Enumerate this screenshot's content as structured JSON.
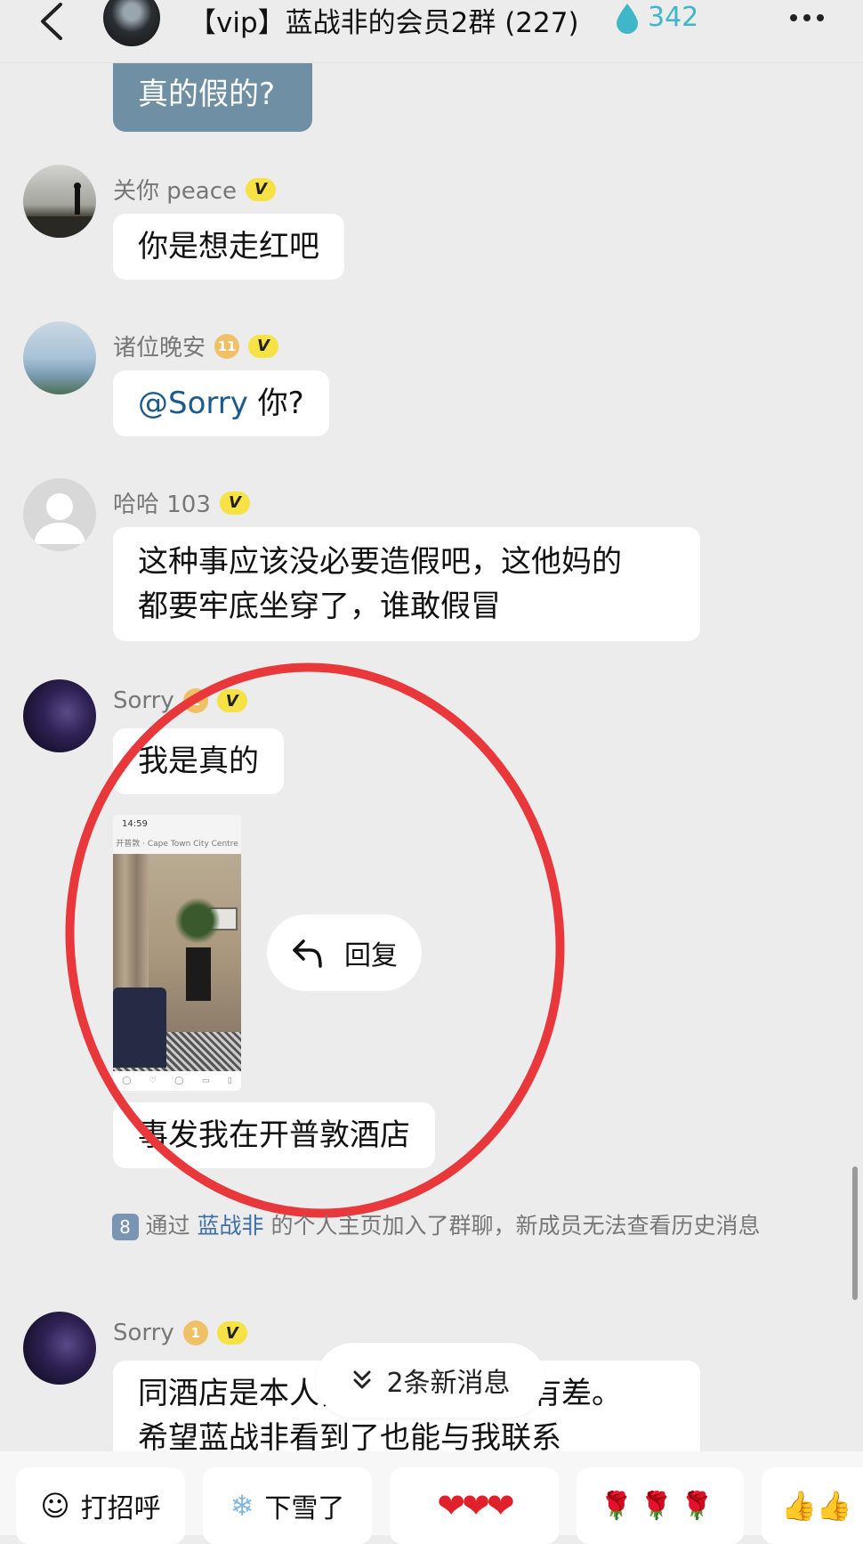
{
  "header": {
    "back_icon": "chevron-left-icon",
    "title": "【vip】蓝战非的会员2群 (227)",
    "heat_icon": "water-drop-icon",
    "heat_count": "342",
    "more_icon": "more-horizontal-icon"
  },
  "messages": [
    {
      "id": "m1",
      "sender": "",
      "self": true,
      "text": "真的假的?"
    },
    {
      "id": "m2",
      "sender": "关你 peace",
      "badges": [
        "v"
      ],
      "text": "你是想走红吧"
    },
    {
      "id": "m3",
      "sender": "诸位晚安",
      "level": "11",
      "badges": [
        "v"
      ],
      "mention": "@Sorry",
      "text": " 你?"
    },
    {
      "id": "m4",
      "sender": "哈哈 103",
      "badges": [
        "v"
      ],
      "lines": [
        "这种事应该没必要造假吧，这他妈的",
        "都要牢底坐穿了，谁敢假冒"
      ]
    },
    {
      "id": "m5",
      "sender": "Sorry",
      "level": "1",
      "badges": [
        "v"
      ],
      "text": "我是真的",
      "image": "hotel-room-screenshot",
      "image_status_time": "14:59",
      "image_nav_title": "开普敦 · Cape Town City Centre",
      "caption": "事发我在开普敦酒店"
    },
    {
      "id": "m6",
      "sender": "Sorry",
      "level": "1",
      "badges": [
        "v"
      ],
      "lines": [
        "同酒店是本人，之前说的过程有差。",
        "希望蓝战非看到了也能与我联系"
      ]
    }
  ],
  "reply_popup": {
    "icon": "reply-arrow-icon",
    "label": "回复"
  },
  "system_notice": {
    "number": "8",
    "prefix": "通过 ",
    "link": "蓝战非",
    "suffix": " 的个人主页加入了群聊，新成员无法查看历史消息"
  },
  "new_messages_pill": {
    "icon": "double-chevron-down-icon",
    "label": "2条新消息"
  },
  "quick_replies": [
    {
      "icon": "smile-emoji-icon",
      "label": "打招呼"
    },
    {
      "icon": "snowflake-icon",
      "label": "下雪了"
    },
    {
      "icon": "hearts-icon",
      "label": "❤❤❤"
    },
    {
      "icon": "roses-icon",
      "label": "🌹🌹🌹"
    },
    {
      "icon": "thumbs-up-icon",
      "label": "👍👍"
    }
  ],
  "annotation": {
    "type": "red-circle",
    "color": "#e8383c"
  },
  "colors": {
    "background": "#ececec",
    "self_bubble": "#6f8fa4",
    "vip_badge": "#f6e245",
    "mention": "#1a5a8c",
    "link": "#3d6fa6"
  }
}
